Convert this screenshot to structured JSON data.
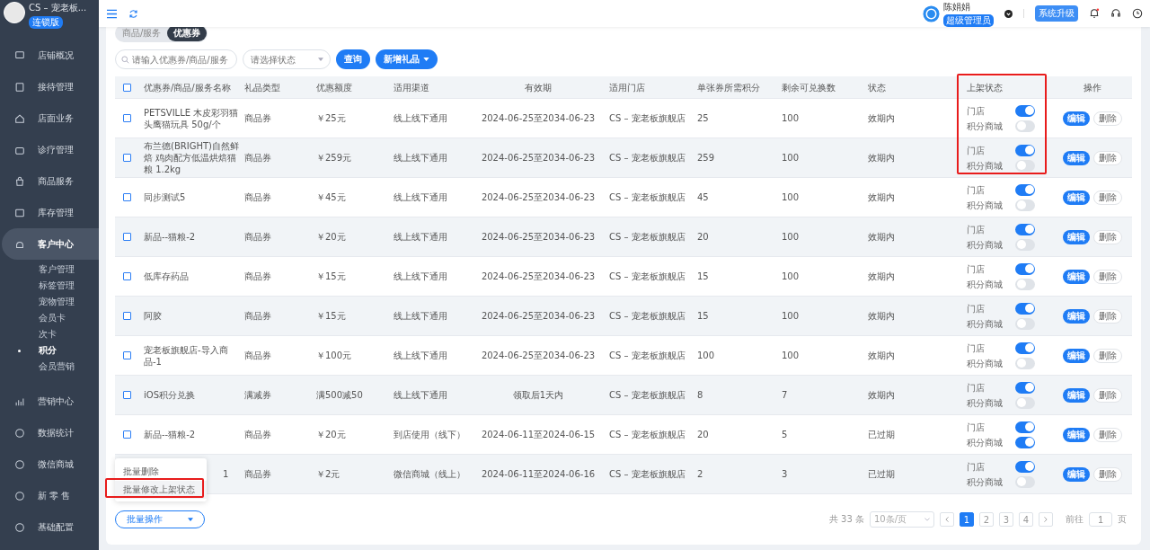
{
  "sidebar": {
    "shop_name": "CS – 宠老板...",
    "edition": "连锁版",
    "items": [
      {
        "label": "店铺概况",
        "expanded": false
      },
      {
        "label": "接待管理",
        "expanded": false
      },
      {
        "label": "店面业务",
        "expanded": false
      },
      {
        "label": "诊疗管理",
        "expanded": false
      },
      {
        "label": "商品服务",
        "expanded": false
      },
      {
        "label": "库存管理",
        "expanded": false
      },
      {
        "label": "客户中心",
        "expanded": true,
        "children": [
          {
            "label": "客户管理",
            "selected": false
          },
          {
            "label": "标签管理",
            "selected": false
          },
          {
            "label": "宠物管理",
            "selected": false
          },
          {
            "label": "会员卡",
            "selected": false
          },
          {
            "label": "次卡",
            "selected": false
          },
          {
            "label": "积分",
            "selected": true
          },
          {
            "label": "会员营销",
            "selected": false
          }
        ]
      },
      {
        "label": "营销中心",
        "expanded": false
      },
      {
        "label": "数据统计",
        "expanded": false
      },
      {
        "label": "微信商城",
        "expanded": false
      },
      {
        "label": "新 零 售",
        "expanded": false
      },
      {
        "label": "基础配置",
        "expanded": false
      }
    ]
  },
  "header": {
    "user_name": "陈娟娟",
    "role": "超级管理员",
    "upgrade_button": "系统升级",
    "has_notification": true
  },
  "tabs": [
    {
      "label": "商品/服务",
      "selected": false
    },
    {
      "label": "优惠券",
      "selected": true
    }
  ],
  "filters": {
    "search": {
      "placeholder": "请输入优惠券/商品/服务"
    },
    "status": {
      "placeholder": "请选择状态"
    },
    "query_button": "查询",
    "add_button": "新增礼品"
  },
  "table": {
    "select_all_checked": false,
    "columns": [
      "优惠券/商品/服务名称",
      "礼品类型",
      "优惠额度",
      "适用渠道",
      "有效期",
      "适用门店",
      "单张券所需积分",
      "剩余可兑换数",
      "状态",
      "上架状态",
      "操作"
    ],
    "rows": [
      {
        "checked": false,
        "name": "PETSVILLE 木皮彩羽猫头鹰猫玩具 50g/个",
        "covered": false,
        "type": "商品券",
        "amount": "￥25元",
        "channel": "线上线下通用",
        "validity": "2024-06-25至2034-06-23",
        "store": "CS – 宠老板旗舰店",
        "points": "25",
        "remaining": "100",
        "status": "效期内",
        "store_label": "门店",
        "store_on": true,
        "mall_label": "积分商城",
        "mall_on": false,
        "edit": "编辑",
        "delete": "删除"
      },
      {
        "checked": false,
        "name": "布兰德(BRIGHT)自然鲜焙 鸡肉配方低温烘焙猫粮 1.2kg",
        "covered": false,
        "type": "商品券",
        "amount": "￥259元",
        "channel": "线上线下通用",
        "validity": "2024-06-25至2034-06-23",
        "store": "CS – 宠老板旗舰店",
        "points": "259",
        "remaining": "100",
        "status": "效期内",
        "store_label": "门店",
        "store_on": true,
        "mall_label": "积分商城",
        "mall_on": false,
        "edit": "编辑",
        "delete": "删除"
      },
      {
        "checked": false,
        "name": "同步测试5",
        "covered": false,
        "type": "商品券",
        "amount": "￥45元",
        "channel": "线上线下通用",
        "validity": "2024-06-25至2034-06-23",
        "store": "CS – 宠老板旗舰店",
        "points": "45",
        "remaining": "100",
        "status": "效期内",
        "store_label": "门店",
        "store_on": true,
        "mall_label": "积分商城",
        "mall_on": false,
        "edit": "编辑",
        "delete": "删除"
      },
      {
        "checked": false,
        "name": "新品--猫粮-2",
        "covered": false,
        "type": "商品券",
        "amount": "￥20元",
        "channel": "线上线下通用",
        "validity": "2024-06-25至2034-06-23",
        "store": "CS – 宠老板旗舰店",
        "points": "20",
        "remaining": "100",
        "status": "效期内",
        "store_label": "门店",
        "store_on": true,
        "mall_label": "积分商城",
        "mall_on": false,
        "edit": "编辑",
        "delete": "删除"
      },
      {
        "checked": false,
        "name": "低库存药品",
        "covered": false,
        "type": "商品券",
        "amount": "￥15元",
        "channel": "线上线下通用",
        "validity": "2024-06-25至2034-06-23",
        "store": "CS – 宠老板旗舰店",
        "points": "15",
        "remaining": "100",
        "status": "效期内",
        "store_label": "门店",
        "store_on": true,
        "mall_label": "积分商城",
        "mall_on": false,
        "edit": "编辑",
        "delete": "删除"
      },
      {
        "checked": false,
        "name": "阿胶",
        "covered": false,
        "type": "商品券",
        "amount": "￥15元",
        "channel": "线上线下通用",
        "validity": "2024-06-25至2034-06-23",
        "store": "CS – 宠老板旗舰店",
        "points": "15",
        "remaining": "100",
        "status": "效期内",
        "store_label": "门店",
        "store_on": true,
        "mall_label": "积分商城",
        "mall_on": false,
        "edit": "编辑",
        "delete": "删除"
      },
      {
        "checked": false,
        "name": "宠老板旗舰店-导入商品-1",
        "covered": false,
        "type": "商品券",
        "amount": "￥100元",
        "channel": "线上线下通用",
        "validity": "2024-06-25至2034-06-23",
        "store": "CS – 宠老板旗舰店",
        "points": "100",
        "remaining": "100",
        "status": "效期内",
        "store_label": "门店",
        "store_on": true,
        "mall_label": "积分商城",
        "mall_on": false,
        "edit": "编辑",
        "delete": "删除"
      },
      {
        "checked": false,
        "name": "iOS积分兑换",
        "covered": false,
        "type": "满减券",
        "amount": "满500减50",
        "channel": "线上线下通用",
        "validity": "领取后1天内",
        "store": "CS – 宠老板旗舰店",
        "points": "8",
        "remaining": "7",
        "status": "效期内",
        "store_label": "门店",
        "store_on": true,
        "mall_label": "积分商城",
        "mall_on": false,
        "edit": "编辑",
        "delete": "删除"
      },
      {
        "checked": false,
        "name": "新品--猫粮-2",
        "covered": false,
        "type": "商品券",
        "amount": "￥20元",
        "channel": "到店使用（线下）",
        "validity": "2024-06-11至2024-06-15",
        "store": "CS – 宠老板旗舰店",
        "points": "20",
        "remaining": "5",
        "status": "已过期",
        "store_label": "门店",
        "store_on": true,
        "mall_label": "积分商城",
        "mall_on": true,
        "edit": "编辑",
        "delete": "删除"
      },
      {
        "name": "1",
        "covered": true,
        "type": "商品券",
        "amount": "￥2元",
        "channel": "微信商城（线上）",
        "validity": "2024-06-11至2024-06-16",
        "store": "CS – 宠老板旗舰店",
        "points": "2",
        "remaining": "3",
        "status": "已过期",
        "store_label": "门店",
        "store_on": true,
        "mall_label": "积分商城",
        "mall_on": false,
        "edit": "编辑",
        "delete": "删除"
      }
    ]
  },
  "batch": {
    "button": "批量操作",
    "menu": [
      {
        "label": "批量删除",
        "selected": false
      },
      {
        "label": "批量修改上架状态",
        "selected": true
      }
    ]
  },
  "pagination": {
    "total": "共 33 条",
    "page_size": "10条/页",
    "pages": [
      {
        "label": "1",
        "selected": true
      },
      {
        "label": "2",
        "selected": false
      },
      {
        "label": "3",
        "selected": false
      },
      {
        "label": "4",
        "selected": false
      }
    ],
    "goto_label": "前往",
    "goto_value": "1",
    "goto_suffix": "页"
  }
}
